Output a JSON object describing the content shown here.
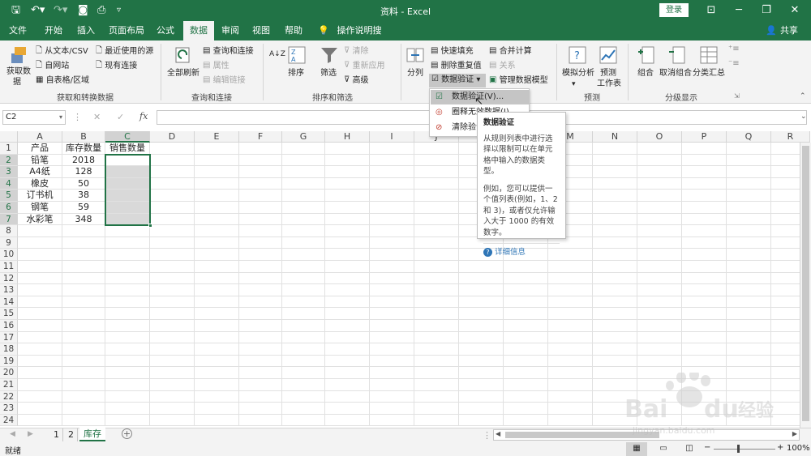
{
  "titlebar": {
    "doc_title": "资料 - Excel",
    "login": "登录"
  },
  "tabs": [
    {
      "label": "文件"
    },
    {
      "label": "开始"
    },
    {
      "label": "插入"
    },
    {
      "label": "页面布局"
    },
    {
      "label": "公式"
    },
    {
      "label": "数据"
    },
    {
      "label": "审阅"
    },
    {
      "label": "视图"
    },
    {
      "label": "帮助"
    },
    {
      "label": "操作说明搜索"
    }
  ],
  "share": "共享",
  "ribbon": {
    "get_data": {
      "big": "获取数",
      "big2": "据",
      "from_csv": "从文本/CSV",
      "from_web": "自网站",
      "from_table": "自表格/区域",
      "recent": "最近使用的源",
      "existing": "现有连接",
      "group": "获取和转换数据"
    },
    "queries": {
      "refresh_all": "全部刷新",
      "queries_conn": "查询和连接",
      "props": "属性",
      "edit_links": "编辑链接",
      "group": "查询和连接"
    },
    "sort_filter": {
      "sort_az": "A↓Z",
      "sort": "排序",
      "filter": "筛选",
      "clear": "清除",
      "reapply": "重新应用",
      "advanced": "高级",
      "group": "排序和筛选"
    },
    "data_tools": {
      "split": "分列",
      "flash_fill": "快速填充",
      "remove_dup": "删除重复值",
      "validation": "数据验证",
      "consolidate": "合并计算",
      "relations": "关系",
      "data_model": "管理数据模型"
    },
    "forecast": {
      "what_if": "模拟分析",
      "forecast_sheet": "预测",
      "forecast_sheet2": "工作表",
      "group": "预测"
    },
    "outline": {
      "group_btn": "组合",
      "ungroup": "取消组合",
      "subtotal": "分类汇总",
      "group": "分级显示"
    }
  },
  "formula": {
    "namebox": "C2",
    "fx": "fx",
    "cancel": "✕",
    "enter": "✓"
  },
  "columns": [
    "A",
    "B",
    "C",
    "D",
    "E",
    "F",
    "G",
    "H",
    "I",
    "J",
    "K",
    "L",
    "M",
    "N",
    "O",
    "P",
    "Q",
    "R"
  ],
  "rows": [
    "1",
    "2",
    "3",
    "4",
    "5",
    "6",
    "7",
    "8",
    "9",
    "10",
    "11",
    "12",
    "13",
    "14",
    "15",
    "16",
    "17",
    "18",
    "19",
    "20",
    "21",
    "22",
    "23",
    "24"
  ],
  "table": [
    [
      "产品",
      "库存数量",
      "销售数量"
    ],
    [
      "铅笔",
      "2018",
      ""
    ],
    [
      "A4纸",
      "128",
      ""
    ],
    [
      "橡皮",
      "50",
      ""
    ],
    [
      "订书机",
      "38",
      ""
    ],
    [
      "钢笔",
      "59",
      ""
    ],
    [
      "水彩笔",
      "348",
      ""
    ]
  ],
  "dropdown": {
    "items": [
      {
        "label": "数据验证(V)..."
      },
      {
        "label": "圈释无效数据(I)"
      },
      {
        "label": "清除验证标识圈(R)"
      }
    ]
  },
  "tooltip": {
    "title": "数据验证",
    "p1": "从规则列表中进行选择以限制可以在单元格中输入的数据类型。",
    "p2": "例如，您可以提供一个值列表(例如，1、2 和 3)，或者仅允许输入大于 1000 的有效数字。",
    "more": "详细信息"
  },
  "sheets": [
    {
      "label": "1"
    },
    {
      "label": "2"
    },
    {
      "label": "库存"
    }
  ],
  "status": {
    "ready": "就绪",
    "zoom": "100%"
  },
  "watermark": {
    "brand": "Baidu经验",
    "url": "jingyan.baidu.com"
  },
  "colors": {
    "excel_green": "#217346",
    "ribbon_bg": "#f3f3f3",
    "selected_fill": "#d9d9d9",
    "info_blue": "#2e75b6"
  }
}
